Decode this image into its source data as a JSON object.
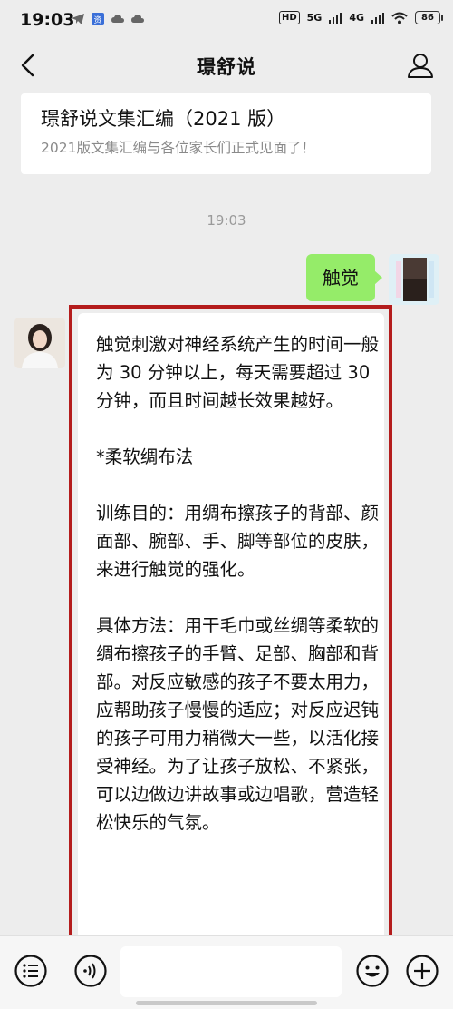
{
  "status_bar": {
    "time": "19:03",
    "network_1": "5G",
    "network_2": "4G",
    "hd": "HD",
    "battery": "86"
  },
  "nav": {
    "title": "璟舒说"
  },
  "article_card": {
    "title": "璟舒说文集汇编（2021 版）",
    "subtitle": "2021版文集汇编与各位家长们正式见面了！"
  },
  "timestamp": "19:03",
  "outgoing": {
    "text": "触觉"
  },
  "incoming": {
    "paragraphs": [
      "触觉刺激对神经系统产生的时间一般为 30 分钟以上，每天需要超过 30 分钟，而且时间越长效果越好。",
      "*柔软绸布法",
      "训练目的：用绸布擦孩子的背部、颜面部、腕部、手、脚等部位的皮肤，来进行触觉的强化。",
      "具体方法：用干毛巾或丝绸等柔软的绸布擦孩子的手臂、足部、胸部和背部。对反应敏感的孩子不要太用力，应帮助孩子慢慢的适应；对反应迟钝的孩子可用力稍微大一些，以活化接受神经。为了让孩子放松、不紧张，可以边做边讲故事或边唱歌，营造轻松快乐的气氛。"
    ]
  },
  "colors": {
    "outgoing_bubble": "#95ec69",
    "highlight_frame": "#b41c1c",
    "background": "#ededed"
  }
}
